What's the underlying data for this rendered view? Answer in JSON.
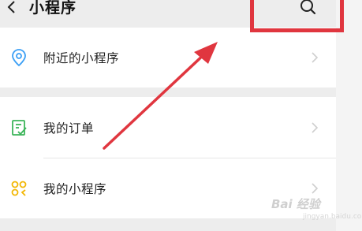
{
  "header": {
    "title": "小程序",
    "back_icon": "back-arrow-icon",
    "search_icon": "search-icon"
  },
  "menu": {
    "nearby": {
      "label": "附近的小程序",
      "icon": "location-pin-icon",
      "color": "#3b9ff5"
    },
    "orders": {
      "label": "我的订单",
      "icon": "order-list-icon",
      "color": "#3cb55a"
    },
    "my_programs": {
      "label": "我的小程序",
      "icon": "mini-program-icon",
      "color": "#f2b705"
    }
  },
  "annotation": {
    "color": "#e0363f"
  },
  "watermark": {
    "text": "Bai 经验",
    "sub": "jingyan.baidu.com"
  }
}
